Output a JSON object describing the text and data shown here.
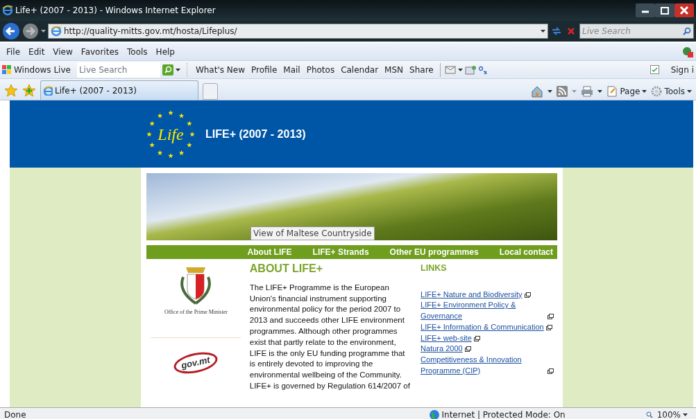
{
  "window": {
    "title": "Life+ (2007 - 2013) - Windows Internet Explorer"
  },
  "address_bar": {
    "url": "http://quality-mitts.gov.mt/hosta/Lifeplus/",
    "search_placeholder": "Live Search"
  },
  "menu": [
    "File",
    "Edit",
    "View",
    "Favorites",
    "Tools",
    "Help"
  ],
  "live_toolbar": {
    "brand": "Windows Live",
    "search_placeholder": "Live Search",
    "links": [
      "What's New",
      "Profile",
      "Mail",
      "Photos",
      "Calendar",
      "MSN",
      "Share"
    ],
    "sign_in": "Sign i"
  },
  "tabs": [
    {
      "label": "Life+ (2007 - 2013)",
      "selected": true
    }
  ],
  "command_bar": [
    "Page",
    "Tools"
  ],
  "page": {
    "header": {
      "logo_text": "Life",
      "title": "LIFE+ (2007 - 2013)"
    },
    "banner": {
      "caption": "View of Maltese Countryside"
    },
    "nav": [
      "About LIFE",
      "LIFE+ Strands",
      "Other EU programmes",
      "Local contact"
    ],
    "sidebar": {
      "opm_caption": "Office of the Prime Minister",
      "govmt_logo": "gov.mt"
    },
    "about": {
      "heading": "ABOUT LIFE+",
      "text": "The LIFE+ Programme is the European Union's financial instrument supporting environmental policy for the period 2007 to 2013 and succeeds other LIFE environment programmes. Although other programmes exist that partly relate to the environment, LIFE is the only EU funding programme that is entirely devoted to improving the environmental wellbeing of the Community. LIFE+ is governed by Regulation 614/2007 of"
    },
    "links": {
      "heading": "LINKS",
      "items": [
        "LIFE+ Nature and Biodiversity",
        "LIFE+ Environment Policy & Governance",
        "LIFE+ Information & Communication",
        "LIFE+ web-site",
        "Natura 2000",
        "Competitiveness & Innovation Programme (CIP)"
      ]
    }
  },
  "status_bar": {
    "text": "Done",
    "zone": "Internet | Protected Mode: On",
    "zoom": "100%"
  }
}
